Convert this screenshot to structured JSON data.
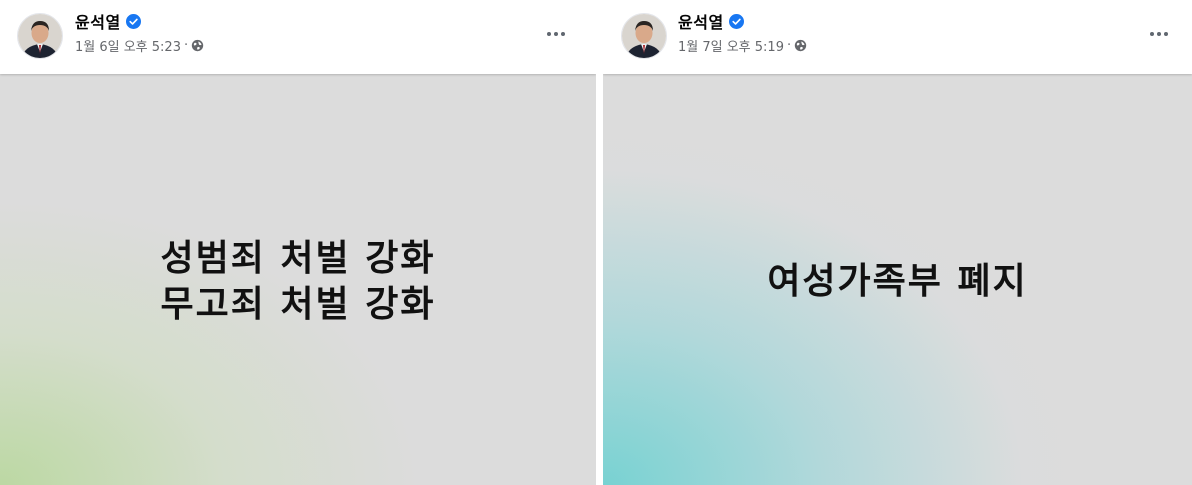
{
  "posts": [
    {
      "author": "윤석열",
      "timestamp": "1월 6일 오후 5:23",
      "separator": "·",
      "privacy_icon": "globe-icon",
      "verified_icon": "verified-badge-icon",
      "more_icon": "more-options-icon",
      "lines": [
        "성범죄 처벌 강화",
        "무고죄 처벌 강화"
      ],
      "background_colors": [
        "#bcd8a0",
        "#dcdcdc"
      ]
    },
    {
      "author": "윤석열",
      "timestamp": "1월 7일 오후 5:19",
      "separator": "·",
      "privacy_icon": "globe-icon",
      "verified_icon": "verified-badge-icon",
      "more_icon": "more-options-icon",
      "lines": [
        "여성가족부 폐지"
      ],
      "background_colors": [
        "#78d2d2",
        "#dcdcdc"
      ]
    }
  ],
  "colors": {
    "verified_blue": "#1877f2",
    "meta_gray": "#65676b",
    "text_dark": "#050505"
  }
}
